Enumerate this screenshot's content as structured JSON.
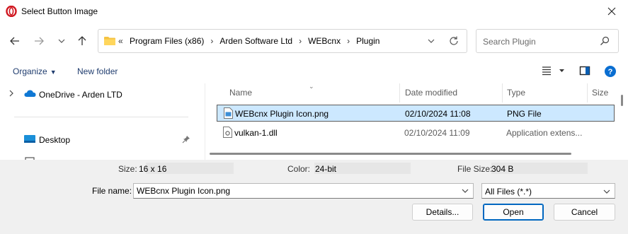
{
  "window": {
    "title": "Select Button Image",
    "close_icon": "close-icon"
  },
  "navigation": {
    "back_icon": "arrow-left-icon",
    "forward_icon": "arrow-right-icon",
    "recent_icon": "chevron-down-icon",
    "up_icon": "arrow-up-icon"
  },
  "address": {
    "overflow": "«",
    "crumbs": [
      "Program Files (x86)",
      "Arden Software Ltd",
      "WEBcnx",
      "Plugin"
    ]
  },
  "search": {
    "placeholder": "Search Plugin"
  },
  "toolbar": {
    "organize_label": "Organize",
    "new_folder_label": "New folder"
  },
  "nav_pane": {
    "items": [
      {
        "label": "OneDrive - Arden LTD",
        "icon": "cloud-icon"
      },
      {
        "label": "Desktop",
        "icon": "desktop-icon"
      }
    ]
  },
  "file_list": {
    "columns": [
      "Name",
      "Date modified",
      "Type",
      "Size"
    ],
    "rows": [
      {
        "name": "WEBcnx Plugin Icon.png",
        "date": "02/10/2024 11:08",
        "type": "PNG File",
        "selected": true
      },
      {
        "name": "vulkan-1.dll",
        "date": "02/10/2024 11:09",
        "type": "Application extens...",
        "selected": false
      }
    ]
  },
  "details": {
    "size_label": "Size:",
    "size_value": "16 x 16",
    "color_label": "Color:",
    "color_value": "24-bit",
    "filesize_label": "File Size:",
    "filesize_value": "304 B"
  },
  "bottom": {
    "file_name_label": "File name:",
    "file_name_value": "WEBcnx Plugin Icon.png",
    "filter_value": "All Files (*.*)",
    "details_button": "Details...",
    "open_button": "Open",
    "cancel_button": "Cancel"
  },
  "colors": {
    "accent": "#0067c0",
    "selection": "#cce8ff",
    "help": "#0a6ed1"
  }
}
